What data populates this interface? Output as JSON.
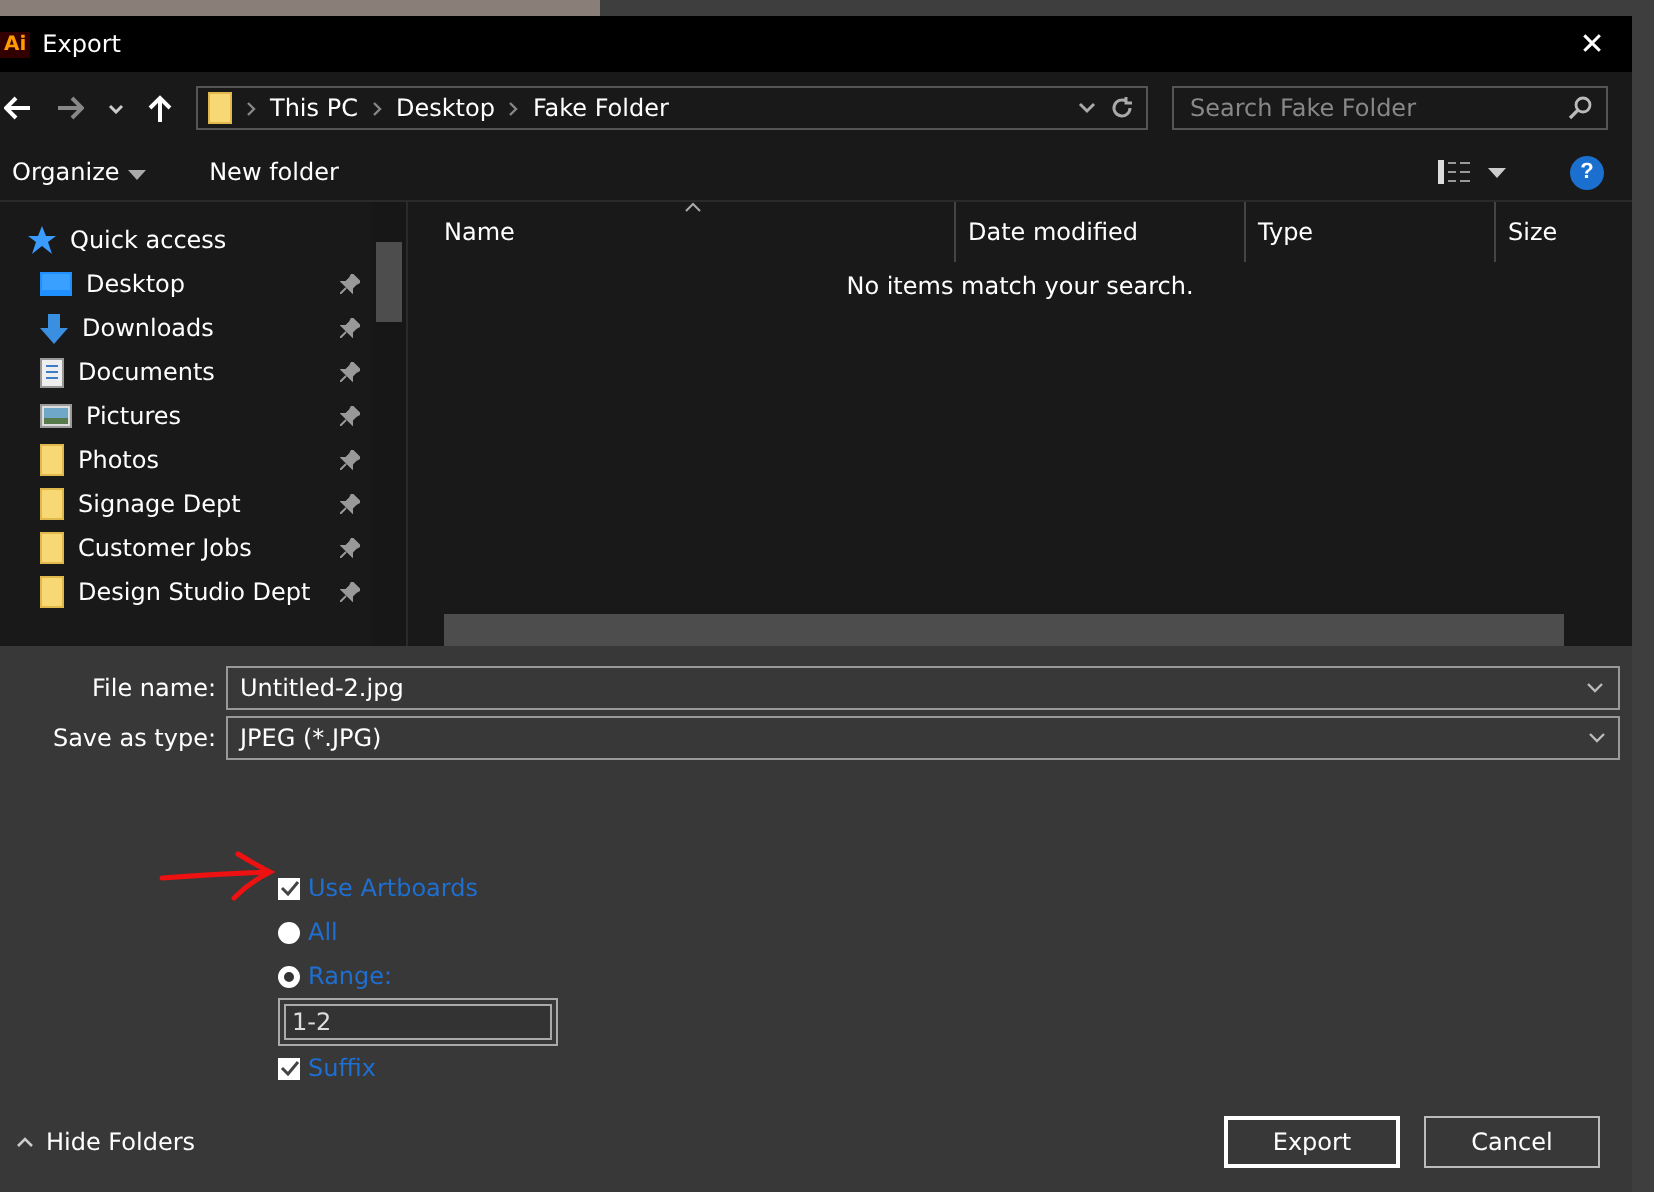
{
  "window": {
    "app_badge": "Ai",
    "title": "Export",
    "close": "✕"
  },
  "address": {
    "path": [
      "This PC",
      "Desktop",
      "Fake Folder"
    ]
  },
  "search": {
    "placeholder": "Search Fake Folder"
  },
  "toolbar": {
    "organize": "Organize",
    "new_folder": "New folder",
    "help": "?"
  },
  "sidebar": {
    "header": "Quick access",
    "items": [
      {
        "label": "Desktop",
        "kind": "desktop",
        "pinned": true
      },
      {
        "label": "Downloads",
        "kind": "downloads",
        "pinned": true
      },
      {
        "label": "Documents",
        "kind": "documents",
        "pinned": true
      },
      {
        "label": "Pictures",
        "kind": "pictures",
        "pinned": true
      },
      {
        "label": "Photos",
        "kind": "folder",
        "pinned": true
      },
      {
        "label": "Signage Dept",
        "kind": "folder",
        "pinned": true
      },
      {
        "label": "Customer Jobs",
        "kind": "folder",
        "pinned": true
      },
      {
        "label": "Design Studio Dept",
        "kind": "folder",
        "pinned": true
      }
    ]
  },
  "table": {
    "columns": [
      "Name",
      "Date modified",
      "Type",
      "Size"
    ],
    "empty_message": "No items match your search."
  },
  "file_name": {
    "label": "File name:",
    "value": "Untitled-2.jpg"
  },
  "save_as_type": {
    "label": "Save as type:",
    "value": "JPEG (*.JPG)"
  },
  "options": [
    {
      "kind": "checkbox",
      "label": "Use Artboards",
      "checked": true
    },
    {
      "kind": "radio",
      "label": "All",
      "selected": false
    },
    {
      "kind": "radio",
      "label": "Range:",
      "selected": true
    },
    {
      "kind": "field",
      "value": "1-2"
    },
    {
      "kind": "checkbox",
      "label": "Suffix",
      "checked": true
    }
  ],
  "hide_folders": "Hide Folders",
  "buttons": [
    "Export",
    "Cancel"
  ]
}
